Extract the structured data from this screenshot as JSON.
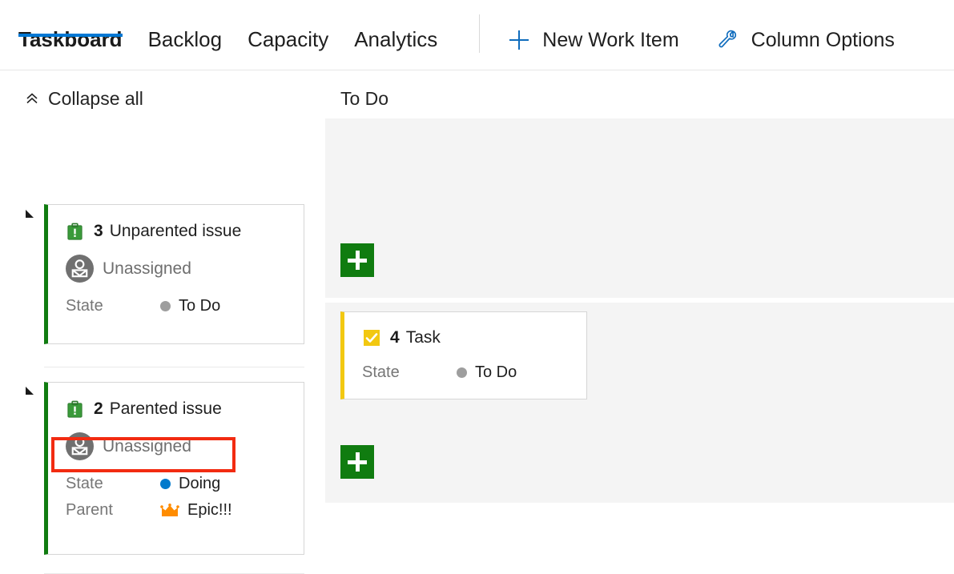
{
  "colors": {
    "accent_blue": "#0078d4",
    "icon_blue": "#0f6cbd",
    "issue_green": "#107c10",
    "task_yellow": "#f2c811",
    "crown_orange": "#ff8c00",
    "annotation_red": "#f22b11",
    "state_todo_gray": "#9e9e9e",
    "state_doing_blue": "#007acc",
    "column_bg": "#f4f4f4"
  },
  "toolbar": {
    "tabs": [
      {
        "label": "Taskboard",
        "selected": true
      },
      {
        "label": "Backlog",
        "selected": false
      },
      {
        "label": "Capacity",
        "selected": false
      },
      {
        "label": "Analytics",
        "selected": false
      }
    ],
    "actions": [
      {
        "label": "New Work Item",
        "icon": "plus-icon"
      },
      {
        "label": "Column Options",
        "icon": "wrench-icon"
      }
    ]
  },
  "backlog": {
    "collapse_all_label": "Collapse all"
  },
  "columns": [
    {
      "label": "To Do"
    }
  ],
  "swimlanes": [
    {
      "id": "lane-unparented",
      "card": {
        "icon": "issue-icon",
        "id": "3",
        "title": "Unparented issue",
        "assignee": "Unassigned",
        "fields": [
          {
            "label": "State",
            "value": "To Do",
            "dot": "#9e9e9e"
          }
        ]
      },
      "tasks": [],
      "add_label": "+"
    },
    {
      "id": "lane-parented",
      "card": {
        "icon": "issue-icon",
        "id": "2",
        "title": "Parented issue",
        "assignee": "Unassigned",
        "fields": [
          {
            "label": "State",
            "value": "Doing",
            "dot": "#007acc"
          },
          {
            "label": "Parent",
            "value": "Epic!!!",
            "icon": "crown-icon",
            "highlighted": true
          }
        ]
      },
      "tasks": [
        {
          "icon": "task-icon",
          "id": "4",
          "title": "Task",
          "fields": [
            {
              "label": "State",
              "value": "To Do",
              "dot": "#9e9e9e"
            }
          ]
        }
      ],
      "add_label": "+"
    }
  ]
}
